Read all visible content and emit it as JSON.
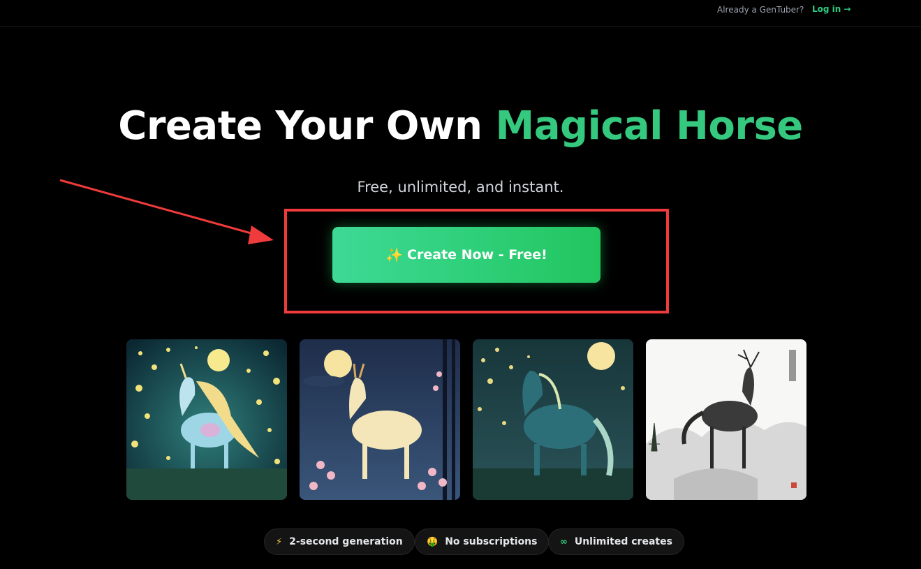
{
  "header": {
    "already_text": "Already a GenTuber?",
    "login_label": "Log in →"
  },
  "hero": {
    "title_part1": "Create Your Own ",
    "title_accent": "Magical Horse",
    "subtitle": "Free, unlimited, and instant.",
    "cta_label": "Create Now - Free!",
    "cta_icon": "sparkles-icon"
  },
  "gallery": [
    {
      "name": "unicorn-firefly-image"
    },
    {
      "name": "deer-blossom-image"
    },
    {
      "name": "teal-horse-image"
    },
    {
      "name": "ink-deer-image"
    }
  ],
  "features": [
    {
      "label": "2-second generation",
      "icon": "⚡",
      "icon_name": "lightning-icon"
    },
    {
      "label": "No subscriptions",
      "icon": "🤑",
      "icon_name": "money-face-icon"
    },
    {
      "label": "Unlimited creates",
      "icon": "∞",
      "icon_name": "infinity-icon"
    }
  ],
  "colors": {
    "accent": "#34c97e",
    "background": "#000000",
    "annotation": "#ef3b3b"
  }
}
